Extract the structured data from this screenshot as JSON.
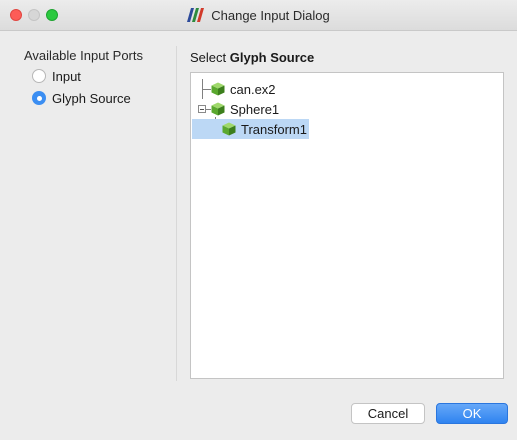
{
  "window": {
    "title": "Change Input Dialog",
    "accent_color": "#3b8ef2"
  },
  "ports": {
    "label": "Available Input Ports",
    "options": [
      {
        "label": "Input",
        "checked": false
      },
      {
        "label": "Glyph Source",
        "checked": true
      }
    ]
  },
  "source": {
    "header_prefix": "Select ",
    "header_bold": "Glyph Source",
    "tree": [
      {
        "label": "can.ex2",
        "icon": "cube-icon",
        "selected": false
      },
      {
        "label": "Sphere1",
        "icon": "cube-icon",
        "selected": false,
        "expanded": true
      },
      {
        "label": "Transform1",
        "icon": "cube-icon",
        "selected": true
      }
    ]
  },
  "buttons": {
    "cancel": "Cancel",
    "ok": "OK"
  }
}
